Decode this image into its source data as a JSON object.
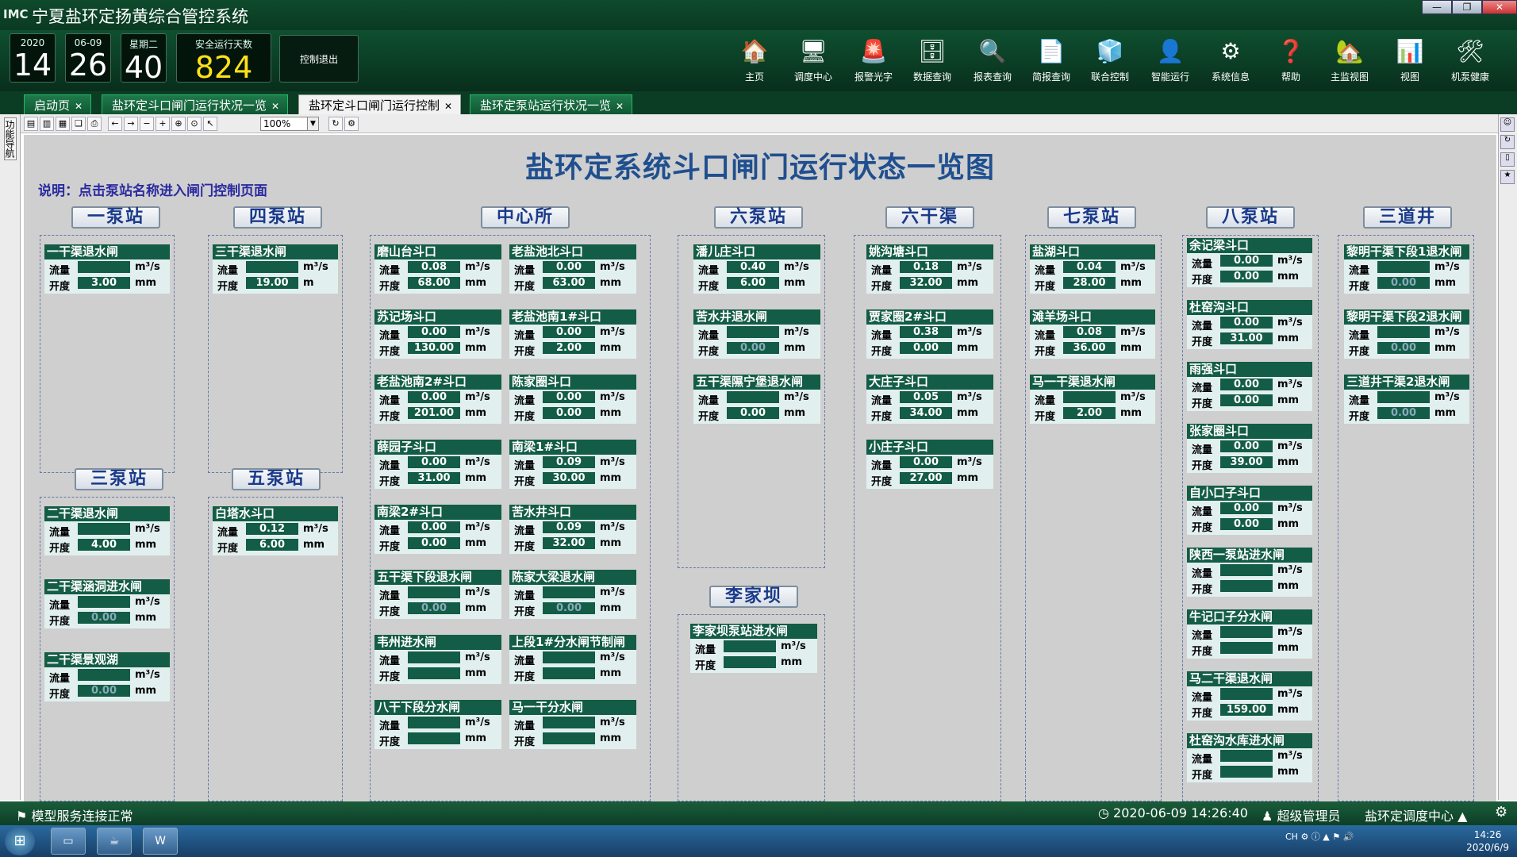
{
  "window": {
    "logo": "IMC",
    "title": "宁夏盐环定扬黄综合管控系统",
    "controls": [
      "—",
      "❐",
      "✕"
    ]
  },
  "header": {
    "year": "2020",
    "day": "14",
    "monthday": "06-09",
    "hour": "26",
    "weekday": "星期二",
    "second": "40",
    "safe_days_label": "安全运行天数",
    "safe_days": "824",
    "exit_label": "控制退出"
  },
  "toolbar": [
    {
      "label": "主页",
      "icon": "home-doc-icon",
      "glyph": "🏠"
    },
    {
      "label": "调度中心",
      "icon": "monitor-icon",
      "glyph": "🖥"
    },
    {
      "label": "报警光字",
      "icon": "alarm-icon",
      "glyph": "🚨"
    },
    {
      "label": "数据查询",
      "icon": "database-icon",
      "glyph": "🗄"
    },
    {
      "label": "报表查询",
      "icon": "magnifier-icon",
      "glyph": "🔍"
    },
    {
      "label": "简报查询",
      "icon": "report-search-icon",
      "glyph": "📄"
    },
    {
      "label": "联合控制",
      "icon": "cubes-icon",
      "glyph": "🧊"
    },
    {
      "label": "智能运行",
      "icon": "user-icon",
      "glyph": "👤"
    },
    {
      "label": "系统信息",
      "icon": "gear-icon",
      "glyph": "⚙"
    },
    {
      "label": "帮助",
      "icon": "help-icon",
      "glyph": "❓"
    },
    {
      "label": "主监视图",
      "icon": "house-icon",
      "glyph": "🏡"
    },
    {
      "label": "视图",
      "icon": "chart-icon",
      "glyph": "📊"
    },
    {
      "label": "机泵健康",
      "icon": "tools-icon",
      "glyph": "🛠"
    }
  ],
  "tabs": [
    {
      "label": "启动页",
      "active": false
    },
    {
      "label": "盐环定斗口闸门运行状况一览",
      "active": false
    },
    {
      "label": "盐环定斗口闸门运行控制",
      "active": true
    },
    {
      "label": "盐环定泵站运行状况一览",
      "active": false
    }
  ],
  "sidenav_label": "功能导航",
  "zoom": "100%",
  "page": {
    "title": "盐环定系统斗口闸门运行状态一览图",
    "note": "说明：点击泵站名称进入闸门控制页面",
    "flow_label": "流量",
    "open_label": "开度",
    "flow_unit": "m³/s",
    "open_unit": "mm",
    "open_unit_m": "m"
  },
  "stations": [
    {
      "name": "一泵站",
      "gates": [
        {
          "name": "一干渠退水闸",
          "flow": "",
          "open": "3.00"
        }
      ]
    },
    {
      "name": "四泵站",
      "gates": [
        {
          "name": "三干渠退水闸",
          "flow": "",
          "open": "19.00",
          "open_unit": "m"
        }
      ]
    },
    {
      "name": "三泵站",
      "gates": [
        {
          "name": "二干渠退水闸",
          "flow": "",
          "open": "4.00"
        },
        {
          "name": "二干渠涵洞进水闸",
          "flow": "",
          "open": "0.00",
          "dim": true
        },
        {
          "name": "二干渠景观湖",
          "flow": "",
          "open": "0.00",
          "dim": true
        }
      ]
    },
    {
      "name": "五泵站",
      "gates": [
        {
          "name": "白塔水斗口",
          "flow": "0.12",
          "open": "6.00"
        }
      ]
    },
    {
      "name": "中心所",
      "gates": [
        {
          "name": "磨山台斗口",
          "flow": "0.08",
          "open": "68.00"
        },
        {
          "name": "老盐池北斗口",
          "flow": "0.00",
          "open": "63.00"
        },
        {
          "name": "苏记场斗口",
          "flow": "0.00",
          "open": "130.00"
        },
        {
          "name": "老盐池南1#斗口",
          "flow": "0.00",
          "open": "2.00"
        },
        {
          "name": "老盐池南2#斗口",
          "flow": "0.00",
          "open": "201.00"
        },
        {
          "name": "陈家圈斗口",
          "flow": "0.00",
          "open": "0.00"
        },
        {
          "name": "薛园子斗口",
          "flow": "0.00",
          "open": "31.00"
        },
        {
          "name": "南梁1#斗口",
          "flow": "0.09",
          "open": "30.00"
        },
        {
          "name": "南梁2#斗口",
          "flow": "0.00",
          "open": "0.00"
        },
        {
          "name": "苦水井斗口",
          "flow": "0.09",
          "open": "32.00"
        },
        {
          "name": "五干渠下段退水闸",
          "flow": "",
          "open": "0.00",
          "dim": true
        },
        {
          "name": "陈家大梁退水闸",
          "flow": "",
          "open": "0.00",
          "dim": true
        },
        {
          "name": "韦州进水闸",
          "flow": "",
          "open": ""
        },
        {
          "name": "上段1#分水闸节制闸",
          "flow": "",
          "open": ""
        },
        {
          "name": "八干下段分水闸",
          "flow": "",
          "open": ""
        },
        {
          "name": "马一干分水闸",
          "flow": "",
          "open": ""
        }
      ]
    },
    {
      "name": "六泵站",
      "gates": [
        {
          "name": "潘儿庄斗口",
          "flow": "0.40",
          "open": "6.00"
        },
        {
          "name": "苦水井退水闸",
          "flow": "",
          "open": "0.00",
          "dim": true
        },
        {
          "name": "五干渠隰宁堡退水闸",
          "flow": "",
          "open": "0.00"
        }
      ]
    },
    {
      "name": "李家坝",
      "gates": [
        {
          "name": "李家坝泵站进水闸",
          "flow": "",
          "open": ""
        }
      ]
    },
    {
      "name": "六干渠",
      "gates": [
        {
          "name": "姚沟塘斗口",
          "flow": "0.18",
          "open": "32.00"
        },
        {
          "name": "贾家圈2#斗口",
          "flow": "0.38",
          "open": "0.00"
        },
        {
          "name": "大庄子斗口",
          "flow": "0.05",
          "open": "34.00"
        },
        {
          "name": "小庄子斗口",
          "flow": "0.00",
          "open": "27.00"
        }
      ]
    },
    {
      "name": "七泵站",
      "gates": [
        {
          "name": "盐湖斗口",
          "flow": "0.04",
          "open": "28.00"
        },
        {
          "name": "滩羊场斗口",
          "flow": "0.08",
          "open": "36.00"
        },
        {
          "name": "马一干渠退水闸",
          "flow": "",
          "open": "2.00"
        }
      ]
    },
    {
      "name": "八泵站",
      "gates": [
        {
          "name": "余记梁斗口",
          "flow": "0.00",
          "open": "0.00"
        },
        {
          "name": "杜窑沟斗口",
          "flow": "0.00",
          "open": "31.00"
        },
        {
          "name": "雨强斗口",
          "flow": "0.00",
          "open": "0.00"
        },
        {
          "name": "张家圈斗口",
          "flow": "0.00",
          "open": "39.00"
        },
        {
          "name": "自小口子斗口",
          "flow": "0.00",
          "open": "0.00"
        },
        {
          "name": "陕西一泵站进水闸",
          "flow": "",
          "open": ""
        },
        {
          "name": "牛记口子分水闸",
          "flow": "",
          "open": ""
        },
        {
          "name": "马二干渠退水闸",
          "flow": "",
          "open": "159.00"
        },
        {
          "name": "杜窑沟水库进水闸",
          "flow": "",
          "open": ""
        }
      ]
    },
    {
      "name": "三道井",
      "gates": [
        {
          "name": "黎明干渠下段1退水闸",
          "flow": "",
          "open": "0.00",
          "dim": true
        },
        {
          "name": "黎明干渠下段2退水闸",
          "flow": "",
          "open": "0.00",
          "dim": true
        },
        {
          "name": "三道井干渠2退水闸",
          "flow": "",
          "open": "0.00",
          "dim": true
        }
      ]
    }
  ],
  "status": {
    "connection": "模型服务连接正常",
    "datetime": "2020-06-09 14:26:40",
    "user": "超级管理员",
    "center": "盐环定调度中心 ▲"
  },
  "taskbar": {
    "lang": "CH",
    "time": "14:26",
    "date": "2020/6/9"
  }
}
